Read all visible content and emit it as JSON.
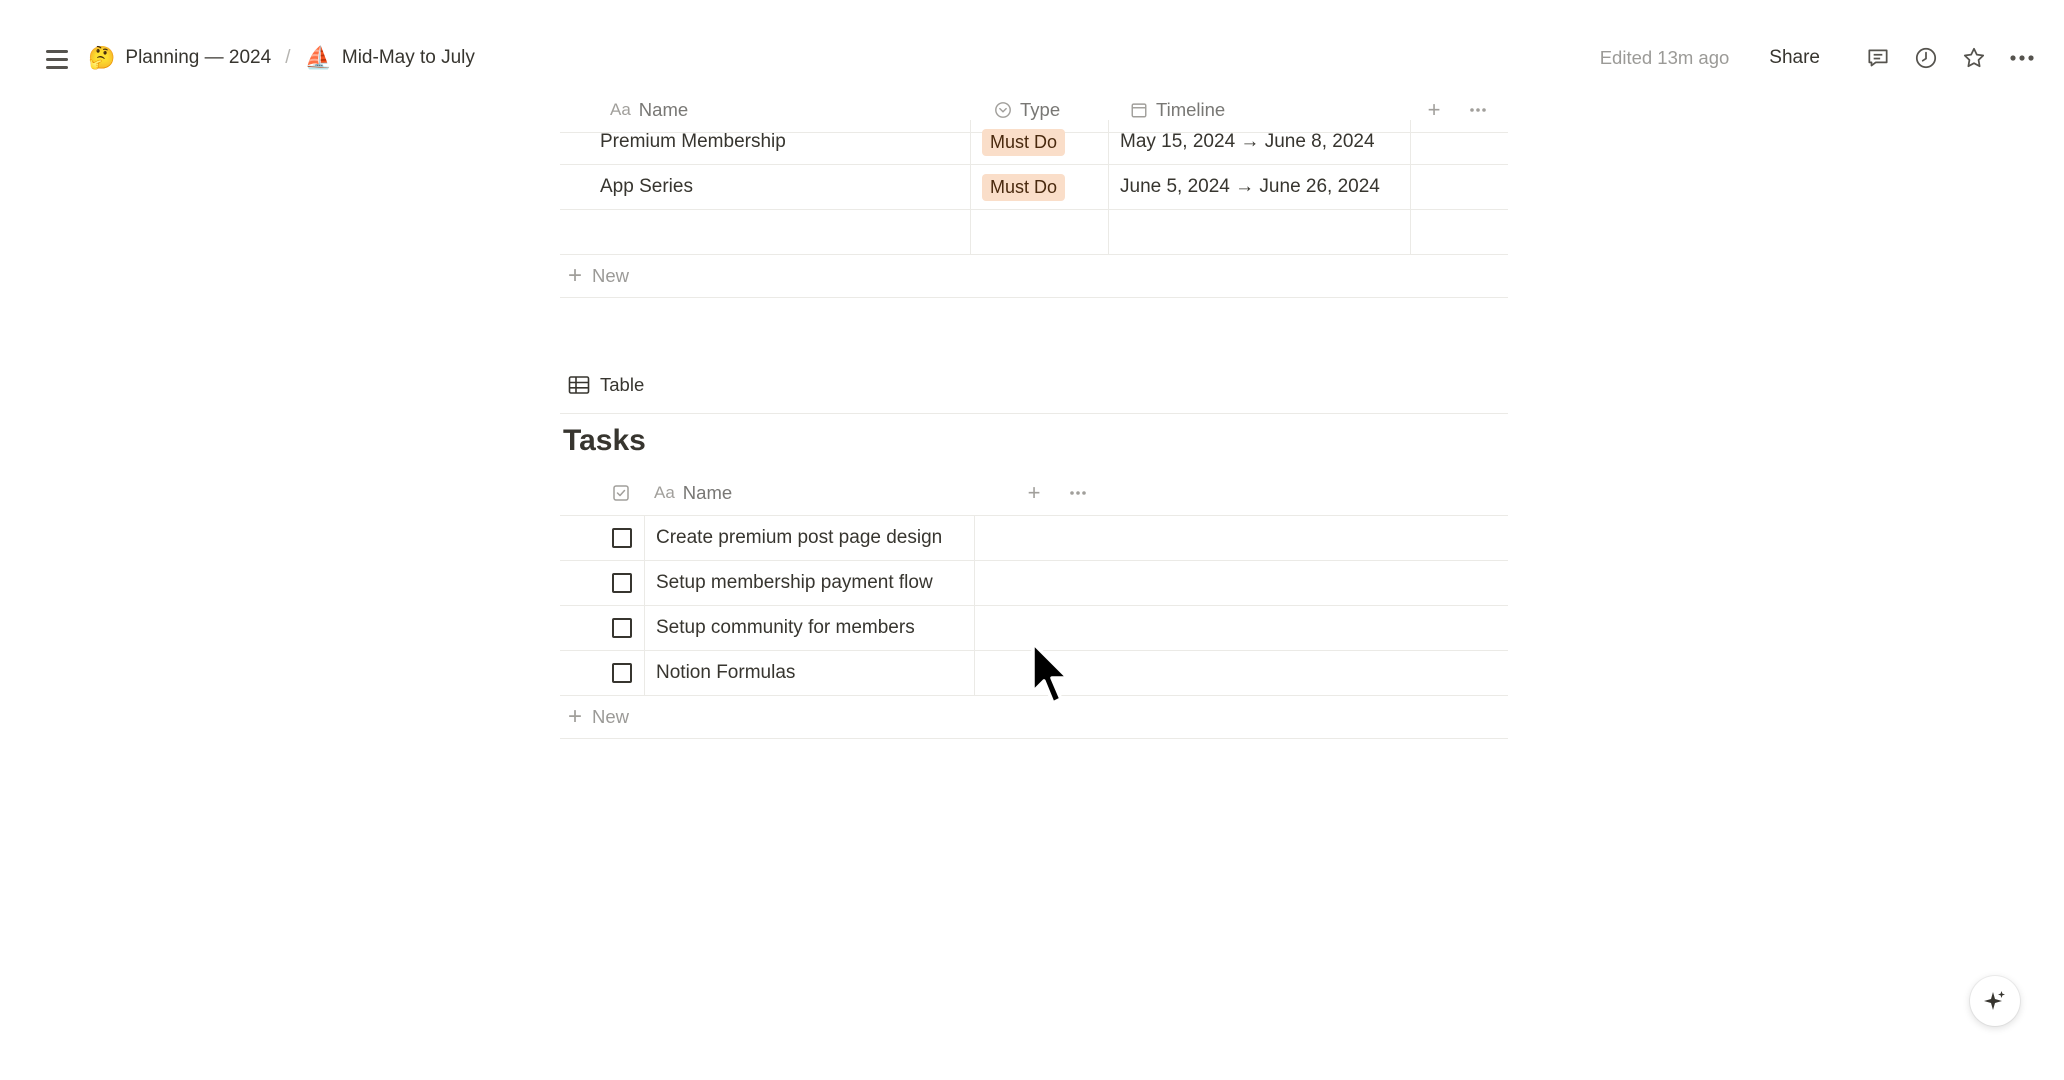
{
  "breadcrumb": {
    "items": [
      {
        "emoji": "🤔",
        "label": "Planning — 2024"
      },
      {
        "emoji": "⛵",
        "label": "Mid-May to July"
      }
    ],
    "separator": "/"
  },
  "topbar": {
    "edited": "Edited 13m ago",
    "share": "Share",
    "icons": [
      "comment-icon",
      "history-icon",
      "star-icon",
      "more-icon"
    ]
  },
  "projects_table": {
    "columns": [
      {
        "label": "Name",
        "icon": "Aa"
      },
      {
        "label": "Type",
        "icon": "select-icon"
      },
      {
        "label": "Timeline",
        "icon": "calendar-icon"
      }
    ],
    "rows": [
      {
        "name": "Premium Membership",
        "type": "Must Do",
        "timeline": "May 15, 2024 → June 8, 2024"
      },
      {
        "name": "App Series",
        "type": "Must Do",
        "timeline": "June 5, 2024 → June 26, 2024"
      },
      {
        "name": "",
        "type": "",
        "timeline": ""
      }
    ],
    "new_label": "New",
    "tag_color": "#fadec9"
  },
  "tasks_view": {
    "view_label": "Table",
    "title": "Tasks",
    "columns": [
      {
        "label": "Name",
        "icon": "Aa"
      }
    ],
    "rows": [
      {
        "name": "Create premium post page design",
        "done": false
      },
      {
        "name": "Setup membership payment flow",
        "done": false
      },
      {
        "name": "Setup community for members",
        "done": false
      },
      {
        "name": "Notion Formulas",
        "done": false
      }
    ],
    "new_label": "New"
  }
}
